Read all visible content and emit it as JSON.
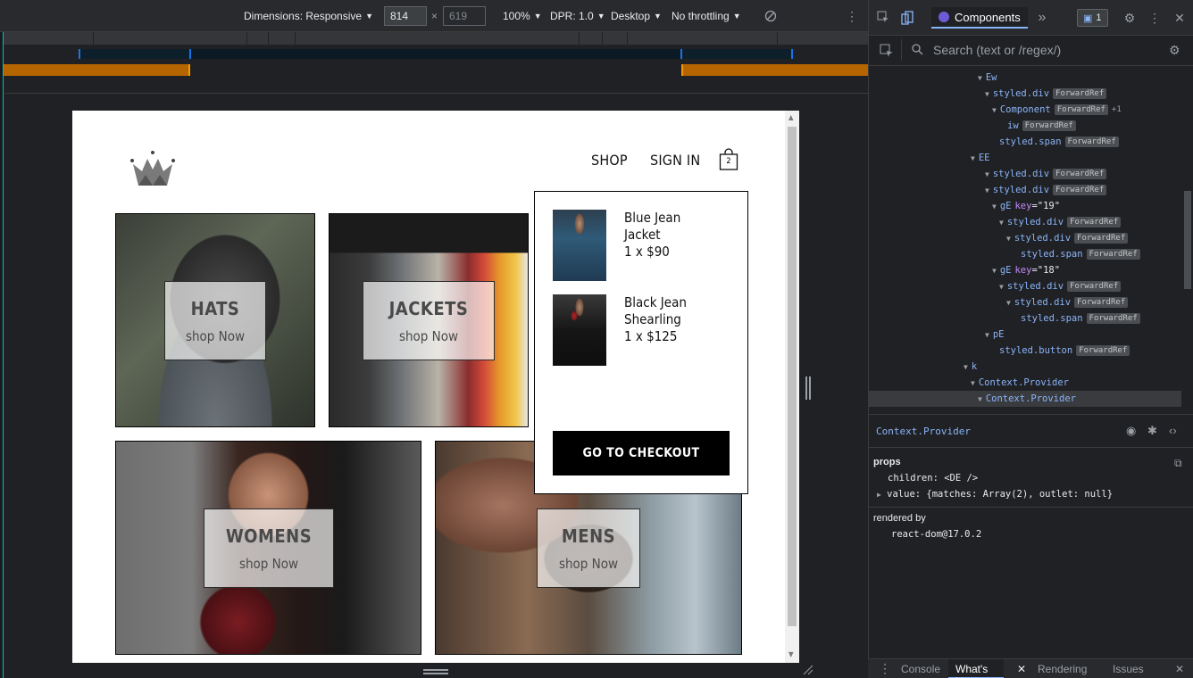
{
  "device_toolbar": {
    "dimensions_label": "Dimensions: Responsive",
    "width": "814",
    "height": "619",
    "zoom": "100%",
    "dpr": "DPR: 1.0",
    "device_type": "Desktop",
    "throttling": "No throttling"
  },
  "site": {
    "nav": {
      "shop": "SHOP",
      "sign_in": "SIGN IN",
      "cart_count": "2"
    },
    "categories": [
      {
        "title": "HATS",
        "subtitle": "shop Now"
      },
      {
        "title": "JACKETS",
        "subtitle": "shop Now"
      },
      {
        "title": "WOMENS",
        "subtitle": "shop Now"
      },
      {
        "title": "MENS",
        "subtitle": "shop Now"
      }
    ],
    "cart": {
      "items": [
        {
          "name": "Blue Jean Jacket",
          "qty_price": "1 x $90"
        },
        {
          "name": "Black Jean Shearling",
          "qty_price": "1 x $125"
        }
      ],
      "checkout_label": "GO TO CHECKOUT"
    }
  },
  "devtools": {
    "active_tab": "Components",
    "issues_count": "1",
    "search_placeholder": "Search (text or /regex/)",
    "tree": [
      {
        "name": "Ew"
      },
      {
        "name": "styled.div",
        "badge": "ForwardRef"
      },
      {
        "name": "Component",
        "badge": "ForwardRef",
        "extra": "+1"
      },
      {
        "name": "iw",
        "badge": "ForwardRef"
      },
      {
        "name": "styled.span",
        "badge": "ForwardRef"
      },
      {
        "name": "EE"
      },
      {
        "name": "styled.div",
        "badge": "ForwardRef"
      },
      {
        "name": "styled.div",
        "badge": "ForwardRef"
      },
      {
        "name": "gE",
        "key_label": "key",
        "key_value": "=\"19\""
      },
      {
        "name": "styled.div",
        "badge": "ForwardRef"
      },
      {
        "name": "styled.div",
        "badge": "ForwardRef"
      },
      {
        "name": "styled.span",
        "badge": "ForwardRef"
      },
      {
        "name": "gE",
        "key_label": "key",
        "key_value": "=\"18\""
      },
      {
        "name": "styled.div",
        "badge": "ForwardRef"
      },
      {
        "name": "styled.div",
        "badge": "ForwardRef"
      },
      {
        "name": "styled.span",
        "badge": "ForwardRef"
      },
      {
        "name": "pE"
      },
      {
        "name": "styled.button",
        "badge": "ForwardRef"
      },
      {
        "name": "k"
      },
      {
        "name": "Context.Provider"
      },
      {
        "name": "Context.Provider"
      }
    ],
    "selected_component": "Context.Provider",
    "props_label": "props",
    "prop_children": "children: <DE />",
    "prop_value": "value: {matches: Array(2), outlet: null}",
    "rendered_by_label": "rendered by",
    "rendered_by_value": "react-dom@17.0.2",
    "drawer_tabs": [
      "Console",
      "What's New",
      "Rendering",
      "Issues"
    ]
  }
}
